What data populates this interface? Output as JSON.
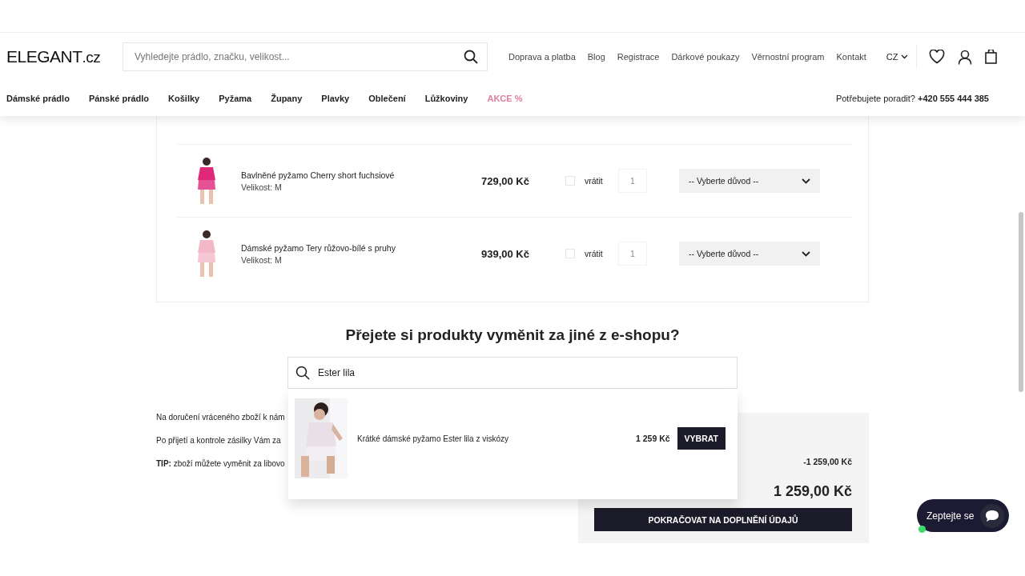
{
  "header": {
    "logo": {
      "main": "ELEGANT",
      "suffix": ".cz"
    },
    "search": {
      "placeholder": "Vyhledejte prádlo, značku, velikost..."
    },
    "links": [
      "Doprava a platba",
      "Blog",
      "Registrace",
      "Dárkové poukazy",
      "Věrnostní program",
      "Kontakt"
    ],
    "language": "CZ"
  },
  "nav": {
    "items": [
      {
        "label": "Dámské prádlo",
        "kind": "normal"
      },
      {
        "label": "Pánské prádlo",
        "kind": "normal"
      },
      {
        "label": "Košilky",
        "kind": "normal"
      },
      {
        "label": "Pyžama",
        "kind": "normal"
      },
      {
        "label": "Župany",
        "kind": "normal"
      },
      {
        "label": "Plavky",
        "kind": "normal"
      },
      {
        "label": "Oblečení",
        "kind": "normal"
      },
      {
        "label": "Lůžkoviny",
        "kind": "normal"
      },
      {
        "label": "AKCE %",
        "kind": "sale"
      }
    ],
    "help_text": "Potřebujete poradit?",
    "phone": "+420 555 444 385"
  },
  "return_items": [
    {
      "name": "Bavlněné pyžamo Cherry short fuchsiové",
      "size": "Velikost: M",
      "price": "729,00 Kč",
      "return_checked": false,
      "return_label": "vrátit",
      "quantity": "1",
      "reason": "-- Vyberte důvod --"
    },
    {
      "name": "Dámské pyžamo Tery růžovo-bílé s pruhy",
      "size": "Velikost: M",
      "price": "939,00 Kč",
      "return_checked": false,
      "return_label": "vrátit",
      "quantity": "1",
      "reason": "-- Vyberte důvod --"
    }
  ],
  "exchange": {
    "heading": "Přejete si produkty vyměnit za jiné z e-shopu?",
    "search_value": "Ester lila",
    "results": [
      {
        "kind": "picture",
        "name": "Krátké dámské pyžamo Ester lila z viskózy",
        "price": "1 259 Kč",
        "button": "VYBRAT"
      }
    ]
  },
  "info": [
    {
      "text": "Na doručení vráceného zboží k nám"
    },
    {
      "text": "Po přijetí a kontrole zásilky Vám za"
    },
    {
      "text": "**TIP:** zboží můžete vyměnit za libovo"
    }
  ],
  "summary": {
    "deduction": "-1 259,00 Kč",
    "total": "1 259,00 Kč",
    "button": "POKRAČOVAT NA DOPLNĚNÍ ÚDAJŮ"
  },
  "chat": {
    "label": "Zeptejte se",
    "online": true
  }
}
